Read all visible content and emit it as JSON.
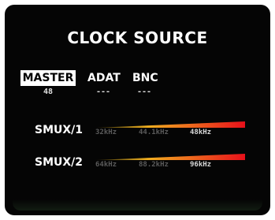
{
  "title": "CLOCK SOURCE",
  "sources": [
    {
      "label": "MASTER",
      "value": "48",
      "selected": true
    },
    {
      "label": "ADAT",
      "value": "---",
      "selected": false
    },
    {
      "label": "BNC",
      "value": "---",
      "selected": false
    }
  ],
  "smux": [
    {
      "label": "SMUX/1",
      "rates": [
        "32kHz",
        "44.1kHz",
        "48kHz"
      ],
      "active_index": 2
    },
    {
      "label": "SMUX/2",
      "rates": [
        "64kHz",
        "88.2kHz",
        "96kHz"
      ],
      "active_index": 2
    }
  ],
  "colors": {
    "background": "#050505",
    "text": "#ffffff",
    "bar_start": "#f0c020",
    "bar_end": "#e8101a",
    "dim_text": "#5a5a5a"
  }
}
